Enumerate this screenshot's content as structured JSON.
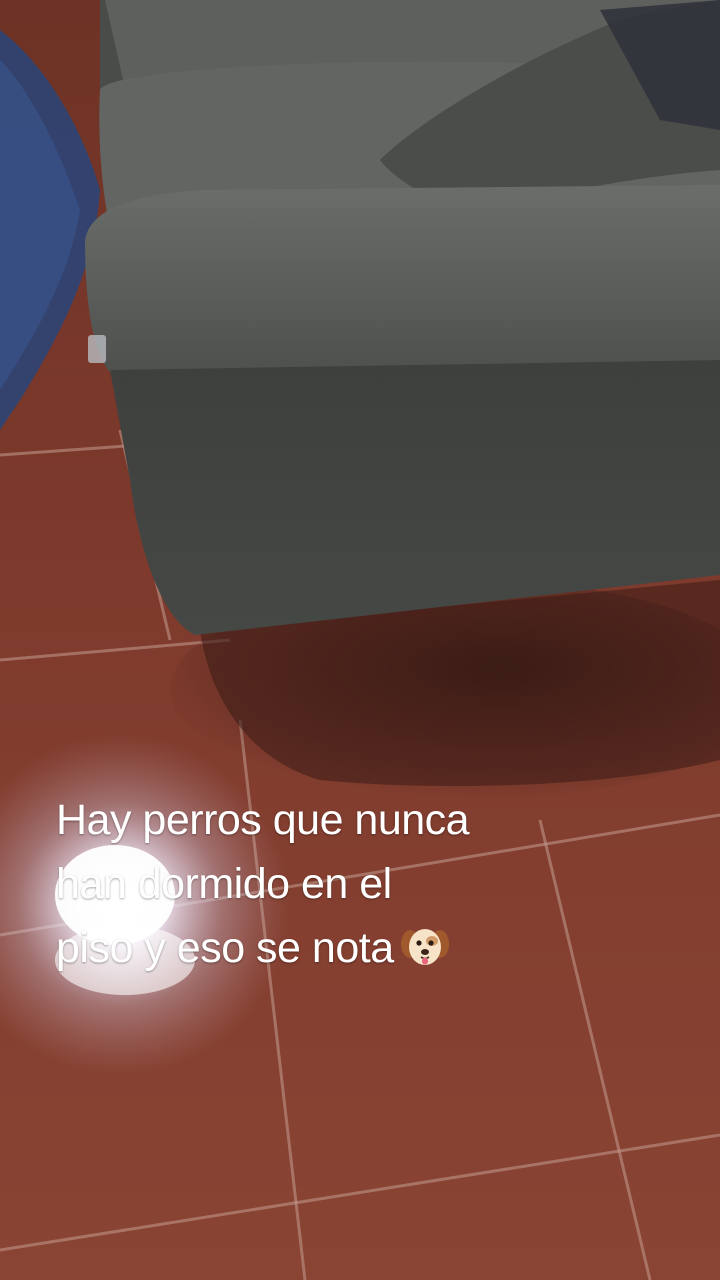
{
  "caption": {
    "line1": "Hay perros que nunca",
    "line2": "han dormido en el",
    "line3": "piso y eso se nota",
    "emoji_icon": "dog-face-icon"
  },
  "scene": {
    "subject": "grey sofa on terracotta tile floor",
    "colors": {
      "sofa": "#5b5e5b",
      "sofa_shadow": "#3b3d3b",
      "floor": "#9a4a3a",
      "grout": "#c9a79c",
      "rug": "#2f4a7a"
    }
  }
}
